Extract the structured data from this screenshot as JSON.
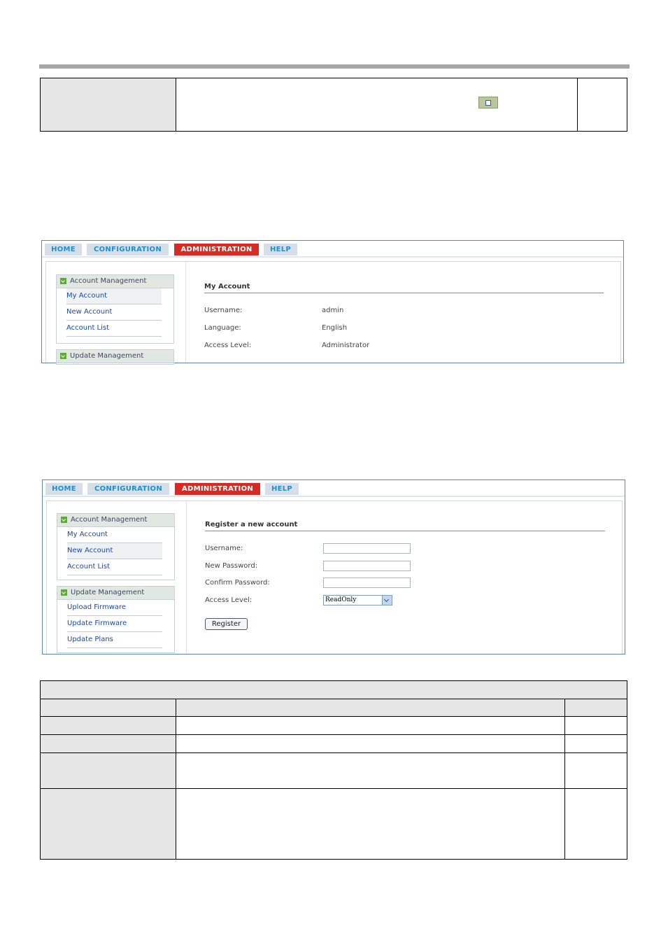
{
  "screen1": {
    "tabs": [
      "HOME",
      "CONFIGURATION",
      "ADMINISTRATION",
      "HELP"
    ],
    "sidebar": {
      "group1": "Account Management",
      "items": [
        "My Account",
        "New Account",
        "Account List"
      ],
      "group2": "Update Management"
    },
    "section_title": "My Account",
    "fields": [
      {
        "label": "Username:",
        "value": "admin"
      },
      {
        "label": "Language:",
        "value": "English"
      },
      {
        "label": "Access Level:",
        "value": "Administrator"
      }
    ]
  },
  "screen2": {
    "tabs": [
      "HOME",
      "CONFIGURATION",
      "ADMINISTRATION",
      "HELP"
    ],
    "sidebar": {
      "group1": "Account Management",
      "items1": [
        "My Account",
        "New Account",
        "Account List"
      ],
      "group2": "Update Management",
      "items2": [
        "Upload Firmware",
        "Update Firmware",
        "Update Plans"
      ]
    },
    "section_title": "Register a new account",
    "labels": [
      "Username:",
      "New Password:",
      "Confirm Password:",
      "Access Level:"
    ],
    "access_level_value": "ReadOnly",
    "register_label": "Register"
  },
  "colors": {
    "accent_tab": "#d62b22",
    "tab_text": "#1d8fd0",
    "link": "#1a4aa8"
  }
}
